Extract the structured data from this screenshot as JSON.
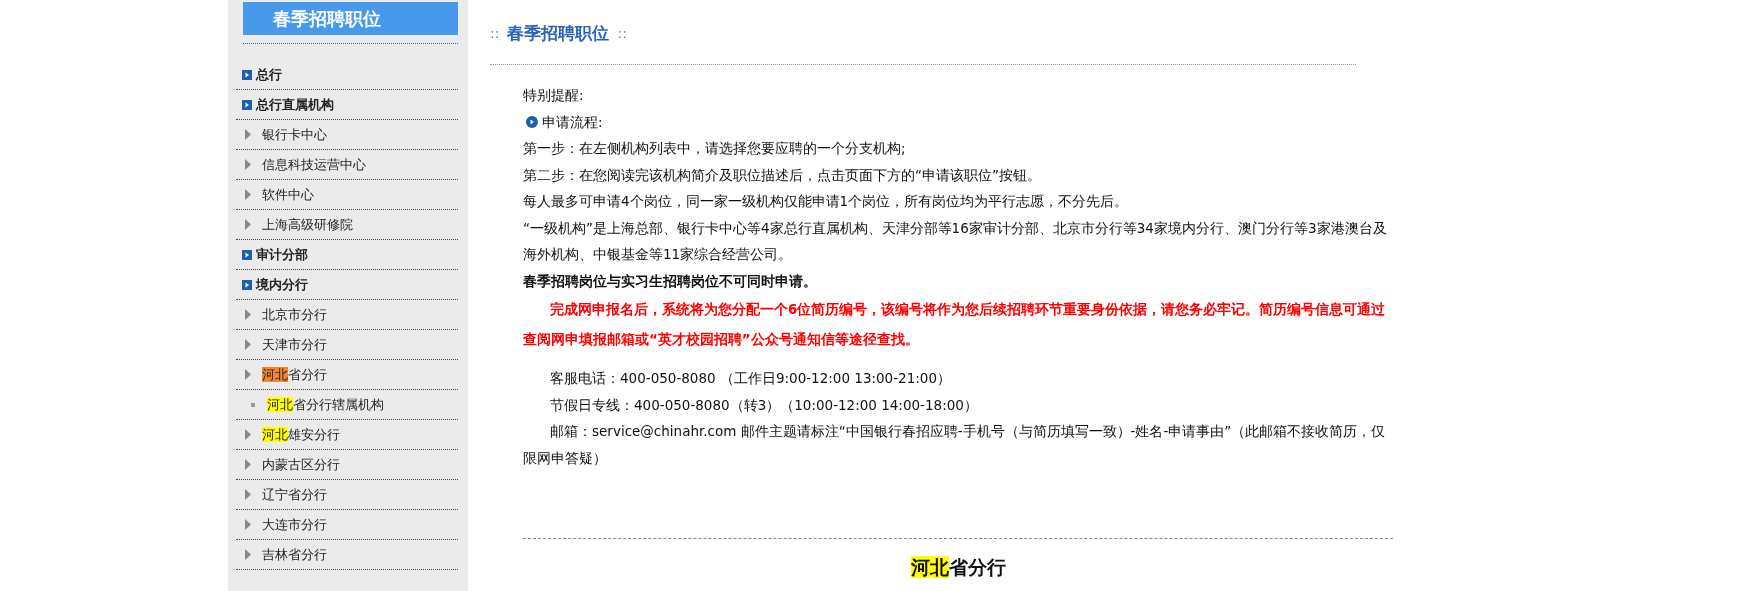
{
  "sidebar": {
    "title": "春季招聘职位",
    "items": [
      {
        "kind": "section",
        "label": "总行"
      },
      {
        "kind": "section",
        "label": "总行直属机构"
      },
      {
        "kind": "branch",
        "label": "银行卡中心"
      },
      {
        "kind": "branch",
        "label": "信息科技运营中心"
      },
      {
        "kind": "branch",
        "label": "软件中心"
      },
      {
        "kind": "branch",
        "label": "上海高级研修院"
      },
      {
        "kind": "section",
        "label": "审计分部"
      },
      {
        "kind": "section",
        "label": "境内分行"
      },
      {
        "kind": "branch",
        "label": "北京市分行"
      },
      {
        "kind": "branch",
        "label": "天津市分行"
      },
      {
        "kind": "branch",
        "match": "河北",
        "color": "#f5882f",
        "label": "省分行"
      },
      {
        "kind": "sub",
        "match": "河北",
        "color": "#ffff00",
        "label": "省分行辖属机构"
      },
      {
        "kind": "branch",
        "match": "河北",
        "color": "#ffff00",
        "label": "雄安分行"
      },
      {
        "kind": "branch",
        "label": "内蒙古区分行"
      },
      {
        "kind": "branch",
        "label": "辽宁省分行"
      },
      {
        "kind": "branch",
        "label": "大连市分行"
      },
      {
        "kind": "branch",
        "label": "吉林省分行"
      }
    ]
  },
  "content": {
    "title": "春季招聘职位",
    "title_marks": "::",
    "notice": [
      {
        "kind": "plain",
        "text": "特别提醒:"
      },
      {
        "kind": "bullet",
        "text": "申请流程:"
      },
      {
        "kind": "plain",
        "text": "第一步：在左侧机构列表中，请选择您要应聘的一个分支机构;"
      },
      {
        "kind": "plain",
        "text": "第二步：在您阅读完该机构简介及职位描述后，点击页面下方的“申请该职位”按钮。"
      },
      {
        "kind": "plain",
        "text": "每人最多可申请4个岗位，同一家一级机构仅能申请1个岗位，所有岗位均为平行志愿，不分先后。"
      },
      {
        "kind": "plain",
        "text": "“一级机构”是上海总部、银行卡中心等4家总行直属机构、天津分部等16家审计分部、北京市分行等34家境内分行、澳门分行等3家港澳台及海外机构、中银基金等11家综合经营公司。"
      },
      {
        "kind": "bold",
        "text": "春季招聘岗位与实习生招聘岗位不可同时申请。"
      },
      {
        "kind": "alert",
        "text": "完成网申报名后，系统将为您分配一个6位简历编号，该编号将作为您后续招聘环节重要身份依据，请您务必牢记。简历编号信息可通过查阅网申填报邮箱或“英才校园招聘”公众号通知信等途径查找。"
      }
    ],
    "contacts": [
      "客服电话：400-050-8080 （工作日9:00-12:00 13:00-21:00）",
      "节假日专线：400-050-8080（转3）（10:00-12:00 14:00-18:00）",
      "邮箱：service@chinahr.com 邮件主题请标注“中国银行春招应聘-手机号（与简历填写一致）-姓名-申请事由”（此邮箱不接收简历，仅限网申答疑）"
    ],
    "branch_heading": {
      "match": "河北",
      "color": "#ffff00",
      "label": "省分行"
    }
  }
}
